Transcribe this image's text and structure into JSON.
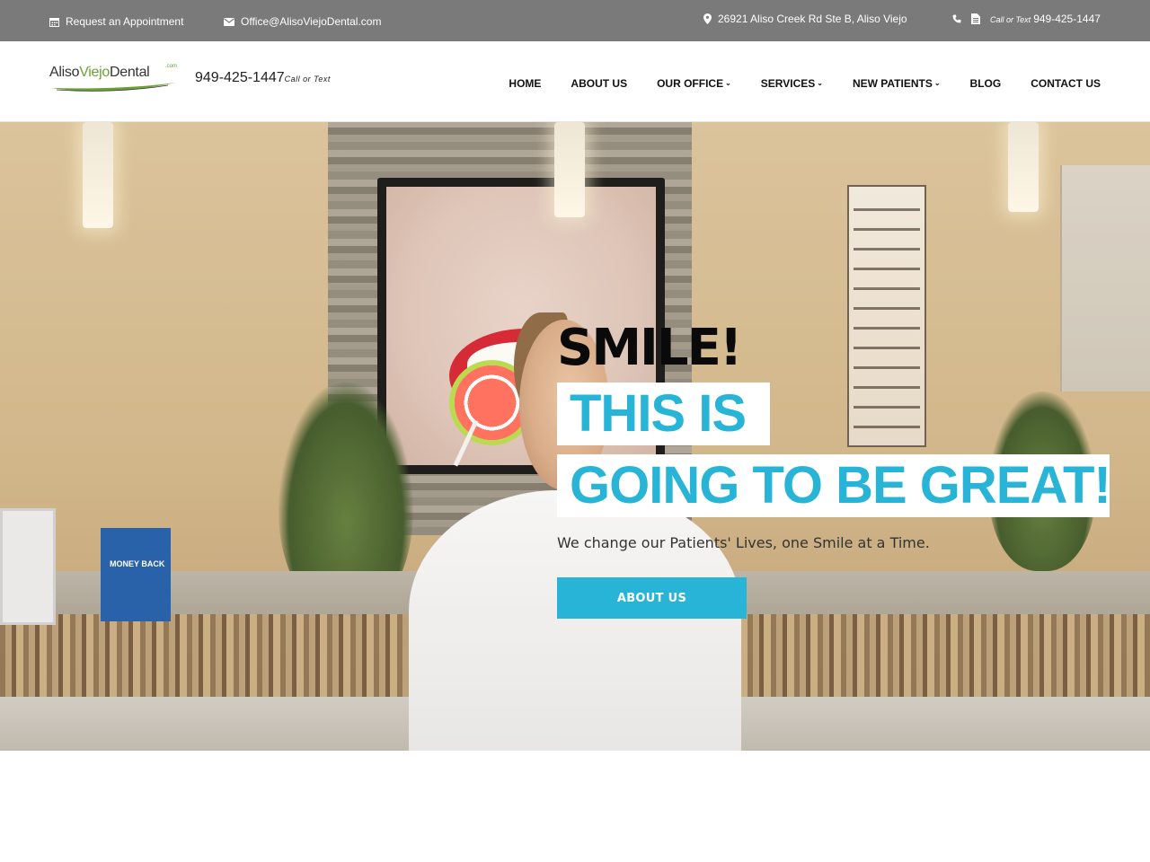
{
  "topbar": {
    "appointment": "Request an Appointment",
    "email": "Office@AlisoViejoDental.com",
    "address": "26921 Aliso Creek Rd Ste B, Aliso Viejo",
    "phone_label": "Call or Text",
    "phone": "949-425-1447"
  },
  "header": {
    "logo": {
      "part1": "Aliso",
      "part2": "Viejo",
      "part3": "Dental",
      "suffix": ".com"
    },
    "phone": "949-425-1447",
    "phone_label": "Call or Text"
  },
  "nav": {
    "items": [
      {
        "label": "HOME",
        "dropdown": false
      },
      {
        "label": "ABOUT US",
        "dropdown": false
      },
      {
        "label": "OUR OFFICE",
        "dropdown": true
      },
      {
        "label": "SERVICES",
        "dropdown": true
      },
      {
        "label": "NEW PATIENTS",
        "dropdown": true
      },
      {
        "label": "BLOG",
        "dropdown": false
      },
      {
        "label": "CONTACT US",
        "dropdown": false
      }
    ]
  },
  "hero": {
    "heading": "SMILE!",
    "highlight_1": "THIS IS",
    "highlight_2": "GOING TO BE GREAT!",
    "subtext": "We change our Patients' Lives, one Smile at a Time.",
    "cta_label": "ABOUT US",
    "brochure_text": "MONEY BACK"
  },
  "colors": {
    "topbar_bg": "#7a7a7a",
    "accent": "#27b4d6",
    "logo_green": "#6aa233"
  }
}
